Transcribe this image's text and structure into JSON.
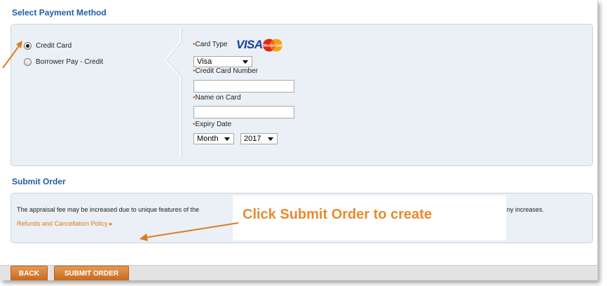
{
  "payment_method": {
    "title": "Select Payment Method",
    "options": [
      {
        "label": "Credit Card",
        "selected": true
      },
      {
        "label": "Borrower Pay - Credit",
        "selected": false
      }
    ],
    "card_type": {
      "label": "Card Type",
      "value": "Visa",
      "logo_visa": "VISA",
      "logo_mastercard": "MasterCard"
    },
    "card_number": {
      "label": "Credit Card Number",
      "value": ""
    },
    "name_on_card": {
      "label": "Name on Card",
      "value": ""
    },
    "expiry": {
      "label": "Expiry Date",
      "month": "Month",
      "year": "2017"
    },
    "required_marker": "•"
  },
  "submit_order": {
    "title": "Submit Order",
    "notice_start": "The appraisal fee may be increased due to unique features of the",
    "notice_end": "ny increases.",
    "policy_link": "Refunds and Cancellation Policy",
    "policy_arrow": "▸"
  },
  "callout": {
    "text": "Click Submit Order to create"
  },
  "buttons": {
    "back": "BACK",
    "submit": "SUBMIT ORDER"
  },
  "colors": {
    "accent": "#e07b1a",
    "title_blue": "#1f5ea8",
    "panel": "#eaf0f5",
    "annotation_arrow": "#e07b1a"
  }
}
